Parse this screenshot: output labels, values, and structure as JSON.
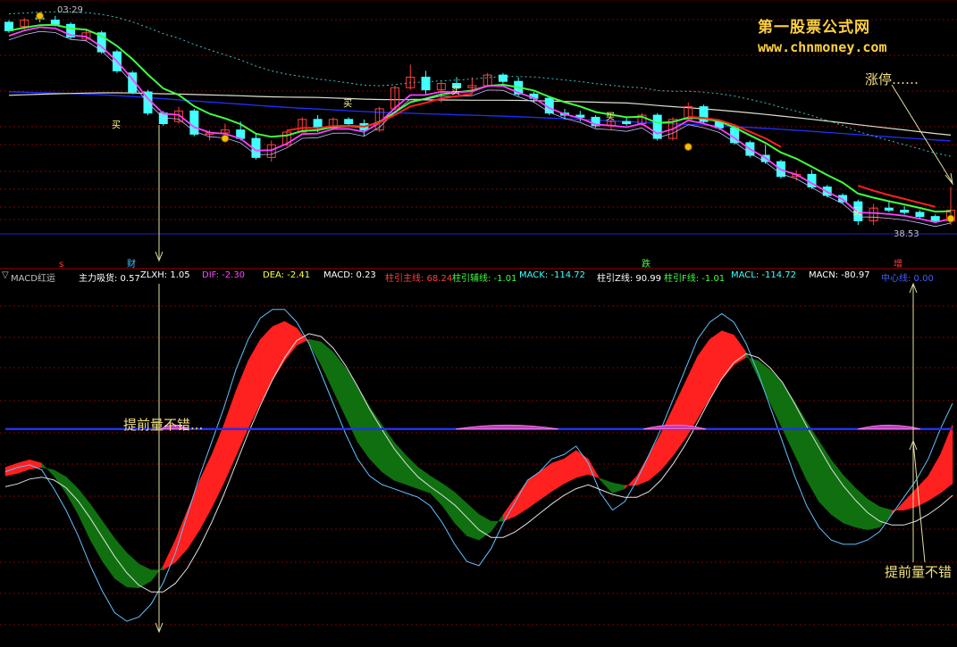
{
  "watermark": {
    "line1": "第一股票公式网",
    "line2": "www.chnmoney.com"
  },
  "price_panel": {
    "time_label": "03:29",
    "last_price_label": "38.53",
    "annotations": {
      "limit_up": "涨停……"
    },
    "buy_marks": [
      "买",
      "买",
      "买",
      "买",
      "买"
    ],
    "bottom_labels": [
      "s",
      "财",
      "跌",
      "增"
    ]
  },
  "indicator_panel": {
    "name": "MACD红运",
    "readouts": [
      {
        "label": "主力吸货:",
        "value": "0.57",
        "color": "#ffffff"
      },
      {
        "label": "ZLXH:",
        "value": "1.05",
        "color": "#ffffff"
      },
      {
        "label": "DIF:",
        "value": "-2.30",
        "color": "#ff44ff"
      },
      {
        "label": "DEA:",
        "value": "-2.41",
        "color": "#ffff40"
      },
      {
        "label": "MACD:",
        "value": "0.23",
        "color": "#ffffff"
      },
      {
        "label": "柱引主线:",
        "value": "68.24",
        "color": "#ff4040"
      },
      {
        "label": "柱引辅线:",
        "value": "-1.01",
        "color": "#40ff40"
      },
      {
        "label": "MACK:",
        "value": "-114.72",
        "color": "#40ffff"
      },
      {
        "label": "柱引Z线:",
        "value": "90.99",
        "color": "#ffffff"
      },
      {
        "label": "柱引F线:",
        "value": "-1.01",
        "color": "#40ff40"
      },
      {
        "label": "MACL:",
        "value": "-114.72",
        "color": "#40ffff"
      },
      {
        "label": "MACN:",
        "value": "-80.97",
        "color": "#ffffff"
      },
      {
        "label": "中心线:",
        "value": "0.00",
        "color": "#4060ff"
      }
    ],
    "annotations": {
      "early_left": "提前量不错...",
      "early_right": "提前量不错"
    }
  },
  "colors": {
    "bg": "#000000",
    "up_candle": "#ff4040",
    "down_candle": "#40ffff",
    "ma_green": "#40ff40",
    "ma_red": "#ff2020",
    "ma_magenta": "#ff40ff",
    "ma_blue": "#2030ff",
    "ma_white": "#e0e0d0",
    "band_red": "#ff2020",
    "band_green": "#107010",
    "grid_red": "#800000"
  },
  "chart_data": [
    {
      "type": "candlestick",
      "series_overlay": [
        "green_ma",
        "magenta_ma",
        "red_ma",
        "white_ma",
        "blue_ma",
        "cyan_dotted"
      ],
      "candles_ohlc": [
        [
          83.0,
          83.5,
          80.5,
          81.0
        ],
        [
          82.0,
          84.0,
          81.0,
          83.5
        ],
        [
          84.0,
          84.6,
          83.0,
          83.8
        ],
        [
          83.5,
          84.5,
          82.0,
          82.5
        ],
        [
          82.5,
          83.0,
          79.0,
          79.5
        ],
        [
          79.0,
          81.5,
          78.5,
          80.5
        ],
        [
          80.5,
          81.0,
          75.5,
          76.0
        ],
        [
          76.0,
          76.5,
          71.0,
          71.5
        ],
        [
          71.0,
          71.5,
          66.0,
          66.5
        ],
        [
          66.5,
          67.0,
          61.0,
          61.5
        ],
        [
          61.5,
          62.0,
          58.5,
          59.0
        ],
        [
          59.5,
          63.0,
          59.0,
          62.0
        ],
        [
          62.0,
          62.5,
          56.0,
          56.5
        ],
        [
          56.5,
          57.5,
          55.0,
          56.8
        ],
        [
          56.8,
          59.0,
          55.0,
          57.5
        ],
        [
          57.5,
          59.5,
          55.0,
          55.5
        ],
        [
          55.5,
          56.5,
          50.5,
          51.0
        ],
        [
          51.0,
          55.0,
          50.0,
          54.0
        ],
        [
          54.0,
          57.5,
          53.5,
          57.0
        ],
        [
          57.0,
          60.5,
          57.0,
          60.0
        ],
        [
          60.0,
          61.0,
          57.0,
          58.0
        ],
        [
          58.0,
          60.5,
          57.5,
          60.0
        ],
        [
          60.0,
          60.5,
          58.5,
          59.0
        ],
        [
          59.0,
          60.0,
          56.0,
          57.5
        ],
        [
          57.5,
          63.0,
          57.0,
          62.5
        ],
        [
          62.5,
          68.0,
          62.0,
          67.5
        ],
        [
          67.5,
          73.0,
          67.0,
          70.0
        ],
        [
          70.0,
          71.5,
          66.0,
          67.0
        ],
        [
          67.0,
          69.0,
          64.0,
          68.5
        ],
        [
          68.5,
          70.0,
          67.0,
          67.5
        ],
        [
          67.5,
          70.0,
          66.0,
          68.0
        ],
        [
          68.0,
          71.0,
          68.0,
          70.5
        ],
        [
          70.5,
          71.0,
          68.5,
          69.0
        ],
        [
          69.0,
          70.0,
          65.5,
          66.0
        ],
        [
          66.0,
          66.5,
          64.0,
          65.0
        ],
        [
          65.0,
          65.5,
          61.0,
          61.5
        ],
        [
          61.5,
          62.5,
          60.0,
          61.0
        ],
        [
          61.0,
          62.0,
          59.5,
          60.5
        ],
        [
          60.5,
          61.0,
          58.0,
          58.5
        ],
        [
          58.5,
          60.0,
          57.5,
          59.5
        ],
        [
          59.5,
          60.5,
          58.5,
          59.0
        ],
        [
          59.0,
          61.5,
          58.5,
          61.0
        ],
        [
          61.0,
          61.5,
          55.0,
          55.5
        ],
        [
          55.5,
          60.5,
          55.0,
          60.0
        ],
        [
          60.0,
          64.0,
          59.5,
          63.0
        ],
        [
          63.0,
          63.5,
          59.0,
          59.5
        ],
        [
          59.5,
          60.0,
          57.5,
          58.0
        ],
        [
          58.0,
          58.5,
          54.0,
          54.5
        ],
        [
          54.5,
          55.0,
          51.0,
          51.5
        ],
        [
          51.5,
          54.0,
          49.5,
          50.0
        ],
        [
          50.0,
          50.5,
          46.0,
          46.5
        ],
        [
          46.5,
          48.0,
          45.5,
          47.0
        ],
        [
          47.0,
          48.0,
          43.5,
          44.0
        ],
        [
          44.0,
          44.5,
          41.5,
          42.0
        ],
        [
          42.0,
          42.5,
          40.0,
          40.5
        ],
        [
          40.5,
          41.0,
          35.0,
          36.0
        ],
        [
          36.0,
          40.0,
          35.0,
          39.0
        ],
        [
          39.0,
          40.5,
          38.0,
          38.5
        ],
        [
          38.5,
          39.5,
          37.5,
          38.0
        ],
        [
          38.0,
          38.5,
          36.5,
          37.0
        ],
        [
          37.0,
          37.5,
          35.5,
          36.0
        ],
        [
          36.0,
          44.0,
          35.0,
          38.5
        ]
      ],
      "ylim": [
        27,
        87
      ]
    },
    {
      "type": "line",
      "title": "MACD红运",
      "series": [
        {
          "name": "DIF",
          "values": [
            -4.5,
            -4.0,
            -3.6,
            -4.0,
            -5.5,
            -7.5,
            -10.0,
            -13.0,
            -15.5,
            -17.5,
            -18.5,
            -18.6,
            -17.8,
            -16.0,
            -13.0,
            -9.5,
            -6.0,
            -3.0,
            0.5,
            4.5,
            8.0,
            10.5,
            12.0,
            12.6,
            11.8,
            10.0,
            7.5,
            4.5,
            1.5,
            -1.5,
            -3.5,
            -5.0,
            -6.0,
            -6.5,
            -7.0,
            -7.5,
            -9.0,
            -11.0,
            -12.5,
            -13.0,
            -12.0,
            -10.0,
            -8.0,
            -6.0,
            -5.0,
            -4.0,
            -3.5,
            -2.5,
            -3.5,
            -6.0,
            -7.5,
            -7.0,
            -5.5,
            -3.0,
            -0.5,
            2.5,
            5.5,
            8.5,
            10.5,
            11.5,
            11.0,
            9.0,
            6.0,
            3.0,
            0.0,
            -3.0,
            -6.0,
            -8.5,
            -10.0,
            -11.0,
            -11.5,
            -11.8,
            -11.5,
            -10.0,
            -8.5,
            -7.0,
            -5.5,
            -3.0,
            0.5
          ]
        },
        {
          "name": "DEA",
          "values": [
            -5.5,
            -5.2,
            -4.7,
            -4.5,
            -4.8,
            -5.6,
            -7.0,
            -8.8,
            -10.8,
            -12.8,
            -14.5,
            -15.8,
            -16.5,
            -16.5,
            -15.6,
            -14.0,
            -11.8,
            -9.2,
            -6.3,
            -3.1,
            0.1,
            3.0,
            5.7,
            8.0,
            9.8,
            10.5,
            10.2,
            9.0,
            7.2,
            5.0,
            2.6,
            0.5,
            -1.5,
            -3.1,
            -4.5,
            -5.5,
            -6.4,
            -7.4,
            -8.7,
            -10.0,
            -10.8,
            -10.8,
            -10.2,
            -9.3,
            -8.3,
            -7.3,
            -6.4,
            -5.7,
            -5.3,
            -5.8,
            -6.3,
            -6.6,
            -6.6,
            -6.0,
            -4.8,
            -3.1,
            -1.1,
            1.2,
            3.6,
            5.8,
            7.5,
            8.4,
            8.0,
            6.9,
            5.4,
            3.2,
            0.8,
            -1.4,
            -3.6,
            -5.4,
            -6.9,
            -8.2,
            -9.1,
            -9.5,
            -9.5,
            -9.1,
            -8.4,
            -7.5,
            -6.4
          ]
        },
        {
          "name": "MACK",
          "values": [
            -5.0,
            -4.5,
            -4.2,
            -4.8,
            -7.0,
            -9.5,
            -12.5,
            -16.0,
            -19.0,
            -21.5,
            -22.5,
            -22.0,
            -20.5,
            -18.0,
            -14.5,
            -10.0,
            -5.5,
            -1.5,
            2.5,
            7.0,
            10.5,
            13.0,
            14.0,
            14.0,
            12.5,
            10.0,
            6.5,
            3.0,
            -0.5,
            -3.5,
            -5.5,
            -6.5,
            -7.0,
            -7.5,
            -8.0,
            -9.0,
            -11.0,
            -13.5,
            -15.5,
            -16.0,
            -14.0,
            -11.0,
            -8.5,
            -6.0,
            -5.0,
            -3.5,
            -3.0,
            -2.0,
            -4.0,
            -7.5,
            -9.5,
            -8.5,
            -6.0,
            -3.0,
            0.0,
            3.5,
            7.0,
            10.5,
            12.5,
            13.5,
            12.5,
            10.0,
            6.5,
            2.5,
            -1.5,
            -5.5,
            -9.0,
            -11.5,
            -13.0,
            -13.5,
            -13.5,
            -13.0,
            -12.0,
            -10.0,
            -8.0,
            -6.0,
            -3.5,
            0.0,
            3.0
          ]
        }
      ],
      "bands": {
        "up_color": "red",
        "down_color": "green",
        "between": [
          "DIF",
          "DEA"
        ]
      },
      "zero_line": 0,
      "ylim": [
        -25,
        17
      ]
    }
  ]
}
